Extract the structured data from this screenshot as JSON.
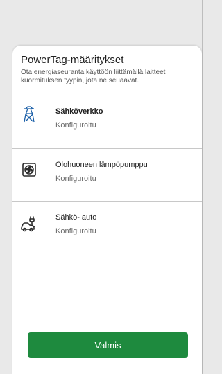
{
  "sheet": {
    "title": "PowerTag-määritykset",
    "description": "Ota energiaseuranta käyttöön liittämällä laitteet kuormituksen tyypin, jota ne seuaavat."
  },
  "loads": [
    {
      "name": "Sähköverkko",
      "status": "Konfiguroitu",
      "icon": "power-grid-icon",
      "selected": true
    },
    {
      "name": "Olohuoneen lämpöpumppu",
      "status": "Konfiguroitu",
      "icon": "heat-pump-icon",
      "selected": false
    },
    {
      "name": "Sähkö- auto",
      "status": "Konfiguroitu",
      "icon": "electric-car-icon",
      "selected": false
    }
  ],
  "actions": {
    "done_label": "Valmis"
  },
  "colors": {
    "primary": "#1e8a3e",
    "text": "#1f1f1f",
    "muted": "#6b6b6b",
    "divider": "#c8c8c8"
  }
}
